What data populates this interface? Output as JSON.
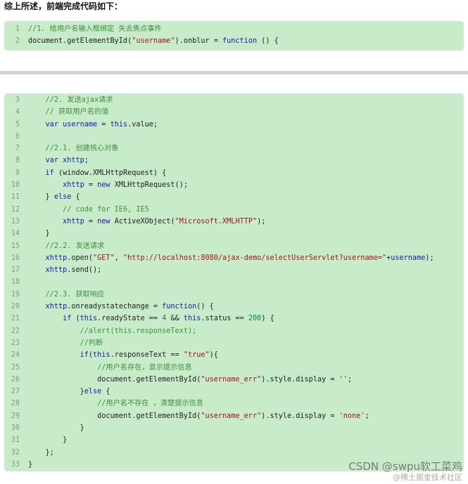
{
  "intro_text": "综上所述，前端完成代码如下：",
  "block1": [
    {
      "n": "1",
      "parts": [
        [
          "c-comment",
          "//1. 给用户名输入框绑定 失去焦点事件"
        ]
      ]
    },
    {
      "n": "2",
      "parts": [
        [
          "",
          "document.getElementById("
        ],
        [
          "c-str",
          "\"username\""
        ],
        [
          "",
          ").onblur = "
        ],
        [
          "c-kw",
          "function"
        ],
        [
          "",
          " () {"
        ]
      ]
    }
  ],
  "block2": [
    {
      "n": "3",
      "parts": [
        [
          "",
          "    "
        ],
        [
          "c-comment",
          "//2. 发送ajax请求"
        ]
      ]
    },
    {
      "n": "4",
      "parts": [
        [
          "",
          "    "
        ],
        [
          "c-comment",
          "// 获取用户名的值"
        ]
      ]
    },
    {
      "n": "5",
      "parts": [
        [
          "",
          "    "
        ],
        [
          "c-kw",
          "var"
        ],
        [
          "",
          " "
        ],
        [
          "c-var",
          "username"
        ],
        [
          "",
          " = "
        ],
        [
          "c-kw",
          "this"
        ],
        [
          "",
          ".value;"
        ]
      ]
    },
    {
      "n": "6",
      "parts": []
    },
    {
      "n": "7",
      "parts": [
        [
          "",
          "    "
        ],
        [
          "c-comment",
          "//2.1. 创建核心对象"
        ]
      ]
    },
    {
      "n": "8",
      "parts": [
        [
          "",
          "    "
        ],
        [
          "c-kw",
          "var"
        ],
        [
          "",
          " "
        ],
        [
          "c-var",
          "xhttp"
        ],
        [
          "",
          ";"
        ]
      ]
    },
    {
      "n": "9",
      "parts": [
        [
          "",
          "    "
        ],
        [
          "c-kw",
          "if"
        ],
        [
          "",
          " (window.XMLHttpRequest) {"
        ]
      ]
    },
    {
      "n": "10",
      "parts": [
        [
          "",
          "        "
        ],
        [
          "c-var",
          "xhttp"
        ],
        [
          "",
          " = "
        ],
        [
          "c-kw",
          "new"
        ],
        [
          "",
          " XMLHttpRequest();"
        ]
      ]
    },
    {
      "n": "11",
      "parts": [
        [
          "",
          "    } "
        ],
        [
          "c-kw",
          "else"
        ],
        [
          "",
          " {"
        ]
      ]
    },
    {
      "n": "12",
      "parts": [
        [
          "",
          "        "
        ],
        [
          "c-comment",
          "// code for IE6, IE5"
        ]
      ]
    },
    {
      "n": "13",
      "parts": [
        [
          "",
          "        "
        ],
        [
          "c-var",
          "xhttp"
        ],
        [
          "",
          " = "
        ],
        [
          "c-kw",
          "new"
        ],
        [
          "",
          " ActiveXObject("
        ],
        [
          "c-str",
          "\"Microsoft.XMLHTTP\""
        ],
        [
          "",
          ");"
        ]
      ]
    },
    {
      "n": "14",
      "parts": [
        [
          "",
          "    }"
        ]
      ]
    },
    {
      "n": "15",
      "parts": [
        [
          "",
          "    "
        ],
        [
          "c-comment",
          "//2.2. 发送请求"
        ]
      ]
    },
    {
      "n": "16",
      "parts": [
        [
          "",
          "    "
        ],
        [
          "c-var",
          "xhttp"
        ],
        [
          "",
          ".open("
        ],
        [
          "c-str",
          "\"GET\""
        ],
        [
          "",
          ", "
        ],
        [
          "c-str",
          "\"http://localhost:8080/ajax-demo/selectUserServlet?username=\""
        ],
        [
          "",
          "+"
        ],
        [
          "c-var",
          "username"
        ],
        [
          "",
          ");"
        ]
      ]
    },
    {
      "n": "17",
      "parts": [
        [
          "",
          "    "
        ],
        [
          "c-var",
          "xhttp"
        ],
        [
          "",
          ".send();"
        ]
      ]
    },
    {
      "n": "18",
      "parts": []
    },
    {
      "n": "19",
      "parts": [
        [
          "",
          "    "
        ],
        [
          "c-comment",
          "//2.3. 获取响应"
        ]
      ]
    },
    {
      "n": "20",
      "parts": [
        [
          "",
          "    "
        ],
        [
          "c-var",
          "xhttp"
        ],
        [
          "",
          ".onreadystatechange = "
        ],
        [
          "c-kw",
          "function"
        ],
        [
          "",
          "() {"
        ]
      ]
    },
    {
      "n": "21",
      "parts": [
        [
          "",
          "        "
        ],
        [
          "c-kw",
          "if"
        ],
        [
          "",
          " ("
        ],
        [
          "c-kw",
          "this"
        ],
        [
          "",
          ".readyState == "
        ],
        [
          "c-num",
          "4"
        ],
        [
          "",
          " && "
        ],
        [
          "c-kw",
          "this"
        ],
        [
          "",
          ".status == "
        ],
        [
          "c-num",
          "200"
        ],
        [
          "",
          ") {"
        ]
      ]
    },
    {
      "n": "22",
      "parts": [
        [
          "",
          "            "
        ],
        [
          "c-comment",
          "//alert(this.responseText);"
        ]
      ]
    },
    {
      "n": "23",
      "parts": [
        [
          "",
          "            "
        ],
        [
          "c-comment",
          "//判断"
        ]
      ]
    },
    {
      "n": "24",
      "parts": [
        [
          "",
          "            "
        ],
        [
          "c-kw",
          "if"
        ],
        [
          "",
          "("
        ],
        [
          "c-kw",
          "this"
        ],
        [
          "",
          ".responseText == "
        ],
        [
          "c-str",
          "\"true\""
        ],
        [
          "",
          "){"
        ]
      ]
    },
    {
      "n": "25",
      "parts": [
        [
          "",
          "                "
        ],
        [
          "c-comment",
          "//用户名存在，显示提示信息"
        ]
      ]
    },
    {
      "n": "26",
      "parts": [
        [
          "",
          "                document.getElementById("
        ],
        [
          "c-str",
          "\"username_err\""
        ],
        [
          "",
          ").style.display = "
        ],
        [
          "c-str",
          "''"
        ],
        [
          "",
          ";"
        ]
      ]
    },
    {
      "n": "27",
      "parts": [
        [
          "",
          "            }"
        ],
        [
          "c-kw",
          "else"
        ],
        [
          "",
          " {"
        ]
      ]
    },
    {
      "n": "28",
      "parts": [
        [
          "",
          "                "
        ],
        [
          "c-comment",
          "//用户名不存在 ，清楚提示信息"
        ]
      ]
    },
    {
      "n": "29",
      "parts": [
        [
          "",
          "                document.getElementById("
        ],
        [
          "c-str",
          "\"username_err\""
        ],
        [
          "",
          ").style.display = "
        ],
        [
          "c-str",
          "'none'"
        ],
        [
          "",
          ";"
        ]
      ]
    },
    {
      "n": "30",
      "parts": [
        [
          "",
          "            }"
        ]
      ]
    },
    {
      "n": "31",
      "parts": [
        [
          "",
          "        }"
        ]
      ]
    },
    {
      "n": "32",
      "parts": [
        [
          "",
          "    };"
        ]
      ]
    },
    {
      "n": "33",
      "parts": [
        [
          "",
          "}"
        ]
      ]
    }
  ],
  "watermark": {
    "main": "CSDN @swpu软工菜鸡",
    "sub": "@稀土掘金技术社区"
  }
}
